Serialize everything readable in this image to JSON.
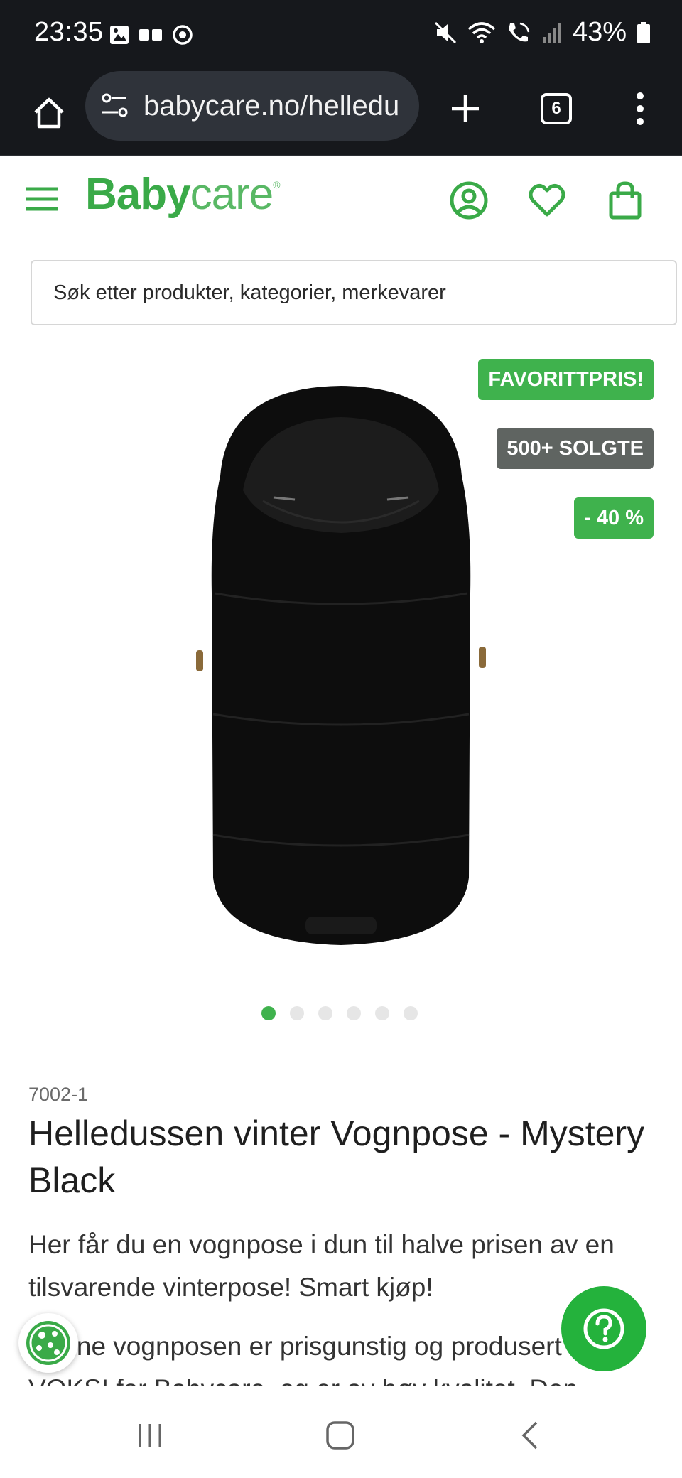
{
  "status_bar": {
    "time": "23:35",
    "battery": "43%",
    "left_icons": [
      "gallery-icon",
      "sim-icon",
      "sync-icon"
    ],
    "right_icons": [
      "mute-icon",
      "wifi-icon",
      "wifi-calling-icon",
      "signal-icon",
      "battery-icon"
    ]
  },
  "browser": {
    "url": "babycare.no/helledu",
    "tab_count": "6"
  },
  "site": {
    "logo_bold": "Baby",
    "logo_light": "care",
    "logo_reg": "®",
    "search_placeholder": "Søk etter produkter, kategorier, merkevarer"
  },
  "product": {
    "badges": {
      "favorite": "FAVORITTPRIS!",
      "sold": "500+ SOLGTE",
      "discount": "- 40 %"
    },
    "image_count": 6,
    "active_image": 1,
    "sku": "7002-1",
    "title": "Helledussen vinter Vognpose - Mystery Black",
    "description": "Her får du en vognpose i dun til halve prisen av en tilsvarende vinterpose! Smart kjøp!",
    "description_2": "Denne vognposen er prisgunstig og produsert av VOKSI for Babycare, og er av høy kvalitet. Den"
  },
  "colors": {
    "brand_green": "#3aaa48",
    "badge_gray": "#5f6461",
    "help_green": "#24b23c",
    "browser_dark": "#16181c"
  }
}
